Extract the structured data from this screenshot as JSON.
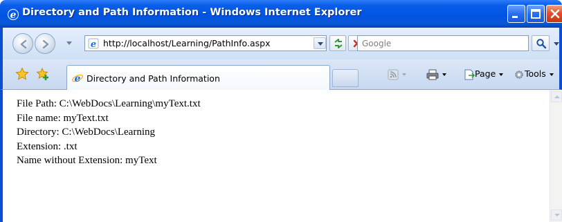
{
  "window": {
    "title": "Directory and Path Information - Windows Internet Explorer",
    "title_icon": "ie-logo-icon",
    "controls": [
      "minimize-icon",
      "maximize-icon",
      "close-icon"
    ]
  },
  "address_bar": {
    "url": "http://localhost/Learning/PathInfo.aspx",
    "icon": "ie-page-icon"
  },
  "search": {
    "placeholder": "Google"
  },
  "tabs": [
    {
      "label": "Directory and Path Information",
      "icon": "ie-page-icon"
    }
  ],
  "command_bar": {
    "page_label": "Page",
    "tools_label": "Tools"
  },
  "content": {
    "lines": [
      "File Path: C:\\WebDocs\\Learning\\myText.txt",
      "File name: myText.txt",
      "Directory: C:\\WebDocs\\Learning",
      "Extension: .txt",
      "Name without Extension: myText"
    ]
  },
  "colors": {
    "titlebar": "#0054e3",
    "frame": "#0a4fd2",
    "toolbar_bg": "#d6e4f6"
  }
}
